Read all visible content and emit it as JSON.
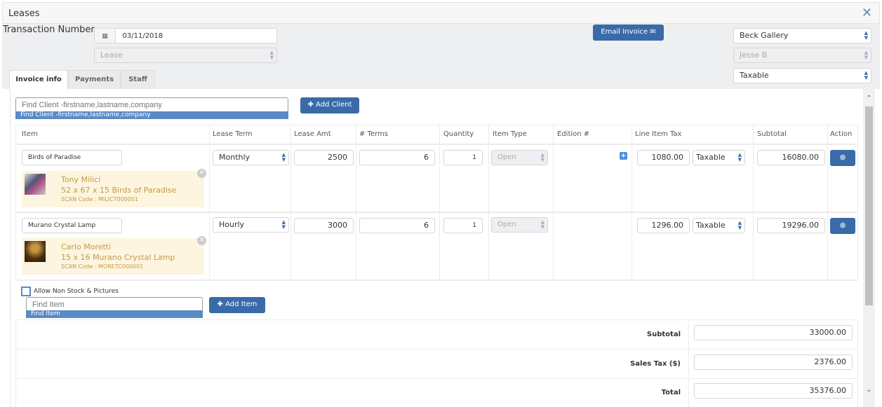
{
  "window": {
    "title": "Leases",
    "close_icon": "close-icon"
  },
  "header": {
    "transaction_label": "Transaction Number",
    "date": "03/11/2018",
    "type_select": "Lease",
    "email_button": "Email Invoice",
    "gallery": "Beck Gallery",
    "staff": "Jesse B",
    "tax_status": "Taxable"
  },
  "tabs": [
    {
      "label": "Invoice info",
      "active": true
    },
    {
      "label": "Payments"
    },
    {
      "label": "Staff"
    }
  ],
  "client": {
    "placeholder": "Find Client -firstname,lastname,company",
    "suggestion": "Find Client -firstname,lastname,company",
    "add_button": "Add Client"
  },
  "table": {
    "headers": [
      "Item",
      "Lease Term",
      "Lease Amt",
      "# Terms",
      "Quantity",
      "Item Type",
      "Edition #",
      "Line Item Tax",
      "Subtotal",
      "Action"
    ],
    "rows": [
      {
        "item": "Birds of Paradise",
        "artist": "Tony Milici",
        "description": "52 x 67 x 15 Birds of Paradise",
        "scan": "SCAN Code : MILICT000001",
        "lease_term": "Monthly",
        "lease_amt": "2500",
        "terms": "6",
        "quantity": "1",
        "item_type": "Open",
        "tax": "1080.00",
        "tax_status": "Taxable",
        "subtotal": "16080.00"
      },
      {
        "item": "Murano Crystal Lamp",
        "artist": "Carlo Moretti",
        "description": "15 x 16 Murano Crystal Lamp",
        "scan": "SCAN Code : MORETC000001",
        "lease_term": "Hourly",
        "lease_amt": "3000",
        "terms": "6",
        "quantity": "1",
        "item_type": "Open",
        "tax": "1296.00",
        "tax_status": "Taxable",
        "subtotal": "19296.00"
      }
    ]
  },
  "items": {
    "allow_label": "Allow Non Stock & Pictures",
    "placeholder": "Find Item",
    "suggestion": "Find Item",
    "add_button": "Add Item"
  },
  "totals": {
    "subtotal_label": "Subtotal",
    "subtotal": "33000.00",
    "tax_label": "Sales Tax ($)",
    "tax": "2376.00",
    "total_label": "Total",
    "total": "35376.00"
  },
  "colors": {
    "primary": "#3a6ba8",
    "card": "#fdf5df",
    "card_text": "#c49a45"
  }
}
